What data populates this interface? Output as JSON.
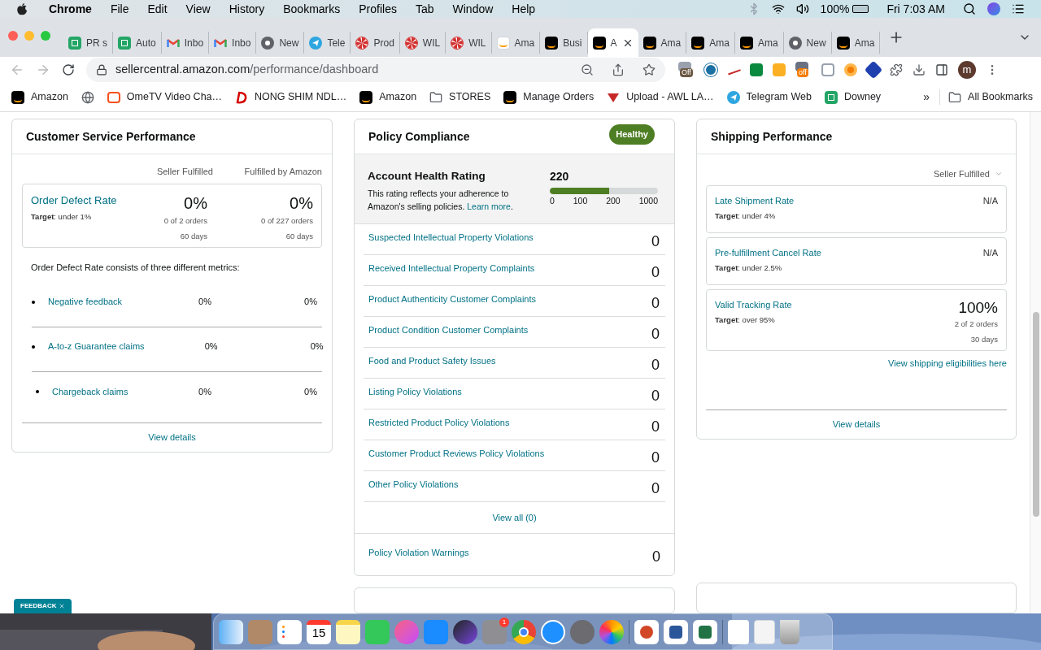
{
  "menu_bar": {
    "app": "Chrome",
    "items": [
      "File",
      "Edit",
      "View",
      "History",
      "Bookmarks",
      "Profiles",
      "Tab",
      "Window",
      "Help"
    ],
    "battery": "100%",
    "clock": "Fri 7:03 AM"
  },
  "tabs": [
    {
      "label": "PR s",
      "kind": "sheets",
      "selected": false
    },
    {
      "label": "Auto",
      "kind": "sheets",
      "selected": false
    },
    {
      "label": "Inbo",
      "kind": "gmail",
      "selected": false
    },
    {
      "label": "Inbo",
      "kind": "gmail",
      "selected": false
    },
    {
      "label": "New",
      "kind": "chrome",
      "selected": false
    },
    {
      "label": "Tele",
      "kind": "telegram",
      "selected": false
    },
    {
      "label": "Prod",
      "kind": "mint",
      "selected": false
    },
    {
      "label": "WIL",
      "kind": "mint",
      "selected": false
    },
    {
      "label": "WIL",
      "kind": "mint",
      "selected": false
    },
    {
      "label": "Ama",
      "kind": "light",
      "selected": false
    },
    {
      "label": "Busi",
      "kind": "amazon",
      "selected": false
    },
    {
      "label": "A",
      "kind": "amazon",
      "selected": true
    },
    {
      "label": "Ama",
      "kind": "amazon",
      "selected": false
    },
    {
      "label": "Ama",
      "kind": "amazon",
      "selected": false
    },
    {
      "label": "Ama",
      "kind": "amazon",
      "selected": false
    },
    {
      "label": "New",
      "kind": "chrome",
      "selected": false
    },
    {
      "label": "Ama",
      "kind": "amazon",
      "selected": false
    }
  ],
  "address": {
    "host": "sellercentral.amazon.com",
    "path": "/performance/dashboard"
  },
  "extensions": {
    "badge_1": "Off",
    "badge_2": "off",
    "avatar": "m"
  },
  "bookmarks": [
    {
      "label": "Amazon",
      "kind": "amazon"
    },
    {
      "kind": "globe"
    },
    {
      "label": "OmeTV Video Cha…",
      "kind": "tv"
    },
    {
      "label": "NONG SHIM NDL…",
      "kind": "d"
    },
    {
      "label": "Amazon",
      "kind": "amazon"
    },
    {
      "label": "STORES",
      "kind": "folder"
    },
    {
      "label": "Manage Orders",
      "kind": "amazon"
    },
    {
      "label": "Upload - AWL LA…",
      "kind": "triangle"
    },
    {
      "label": "Telegram Web",
      "kind": "telegram"
    },
    {
      "label": "Downey",
      "kind": "sheets"
    }
  ],
  "bookmarks_overflow": "»",
  "all_bookmarks": "All Bookmarks",
  "customer_service": {
    "title": "Customer Service Performance",
    "columns": [
      "Seller Fulfilled",
      "Fulfilled by Amazon"
    ],
    "odr": {
      "name": "Order Defect Rate",
      "target_label": "Target",
      "target": ": under 1%",
      "values": [
        {
          "rate": "0%",
          "orders": "0 of 2 orders",
          "period": "60 days"
        },
        {
          "rate": "0%",
          "orders": "0 of 227 orders",
          "period": "60 days"
        }
      ]
    },
    "intro": "Order Defect Rate consists of three different metrics:",
    "metrics": [
      {
        "name": "Negative feedback",
        "values": [
          "0%",
          "0%"
        ]
      },
      {
        "name": "A-to-z Guarantee claims",
        "values": [
          "0%",
          "0%"
        ]
      },
      {
        "name": "Chargeback claims",
        "values": [
          "0%",
          "0%"
        ]
      }
    ],
    "footer": "View details"
  },
  "policy": {
    "title": "Policy Compliance",
    "status": "Healthy",
    "rating": {
      "title": "Account Health Rating",
      "text": "This rating reflects your adherence to Amazon's selling policies.",
      "link": "Learn more",
      "link_end": ".",
      "score": "220",
      "level": 0.55,
      "ticks": [
        "0",
        "100",
        "200",
        "1000"
      ]
    },
    "rows": [
      {
        "name": "Suspected Intellectual Property Violations",
        "count": "0"
      },
      {
        "name": "Received Intellectual Property Complaints",
        "count": "0"
      },
      {
        "name": "Product Authenticity Customer Complaints",
        "count": "0"
      },
      {
        "name": "Product Condition Customer Complaints",
        "count": "0"
      },
      {
        "name": "Food and Product Safety Issues",
        "count": "0"
      },
      {
        "name": "Listing Policy Violations",
        "count": "0"
      },
      {
        "name": "Restricted Product Policy Violations",
        "count": "0"
      },
      {
        "name": "Customer Product Reviews Policy Violations",
        "count": "0"
      },
      {
        "name": "Other Policy Violations",
        "count": "0"
      }
    ],
    "view_all": "View all (0)",
    "warnings": {
      "name": "Policy Violation Warnings",
      "count": "0"
    }
  },
  "shipping": {
    "title": "Shipping Performance",
    "filter": "Seller Fulfilled",
    "metrics": [
      {
        "name": "Late Shipment Rate",
        "target_label": "Target",
        "target": ": under 4%",
        "value": "N/A"
      },
      {
        "name": "Pre-fulfillment Cancel Rate",
        "target_label": "Target",
        "target": ": under 2.5%",
        "value": "N/A"
      },
      {
        "name": "Valid Tracking Rate",
        "target_label": "Target",
        "target": ": over 95%",
        "value": "100%",
        "orders": "2 of 2 orders",
        "period": "30 days"
      }
    ],
    "link": "View shipping eligibilities here",
    "footer": "View details"
  },
  "feedback": "FEEDBACK",
  "dock": {
    "calendar_day": "15",
    "badge": "1"
  }
}
